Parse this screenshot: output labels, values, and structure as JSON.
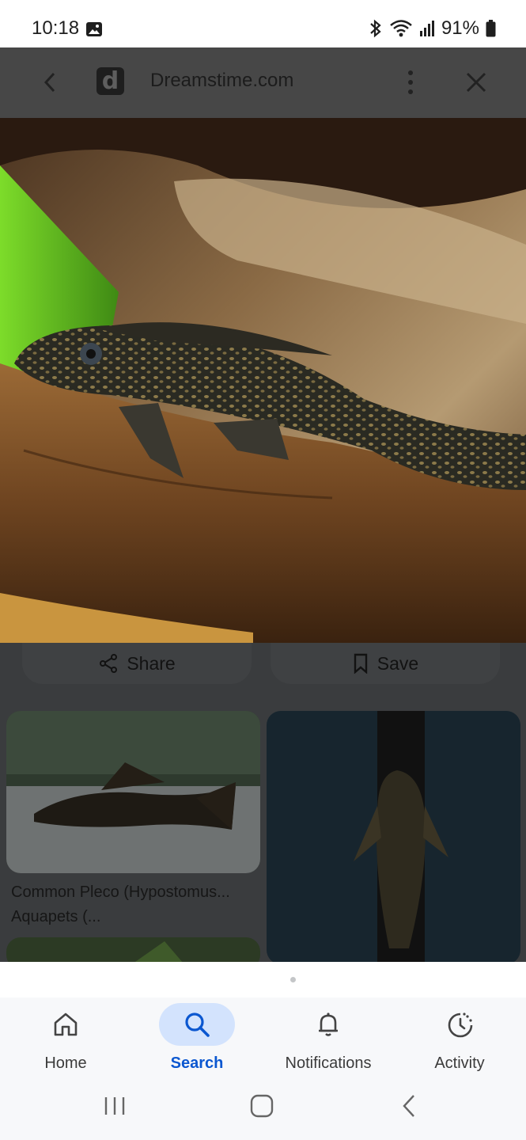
{
  "status_bar": {
    "time": "10:18",
    "battery": "91%"
  },
  "viewer": {
    "site_logo_letter": "d",
    "site_name": "Dreamstime.com"
  },
  "actions": {
    "share": "Share",
    "save": "Save"
  },
  "results": [
    {
      "title": "Common Pleco (Hypostomus...",
      "source": "Aquapets (..."
    }
  ],
  "bottom_nav": {
    "items": [
      {
        "label": "Home",
        "icon": "home-icon",
        "active": false
      },
      {
        "label": "Search",
        "icon": "search-icon",
        "active": true
      },
      {
        "label": "Notifications",
        "icon": "bell-icon",
        "active": false
      },
      {
        "label": "Activity",
        "icon": "activity-icon",
        "active": false
      }
    ]
  },
  "colors": {
    "accent": "#0b57d0",
    "active_pill": "#d3e3fd",
    "scrim": "#3a3c3e"
  }
}
